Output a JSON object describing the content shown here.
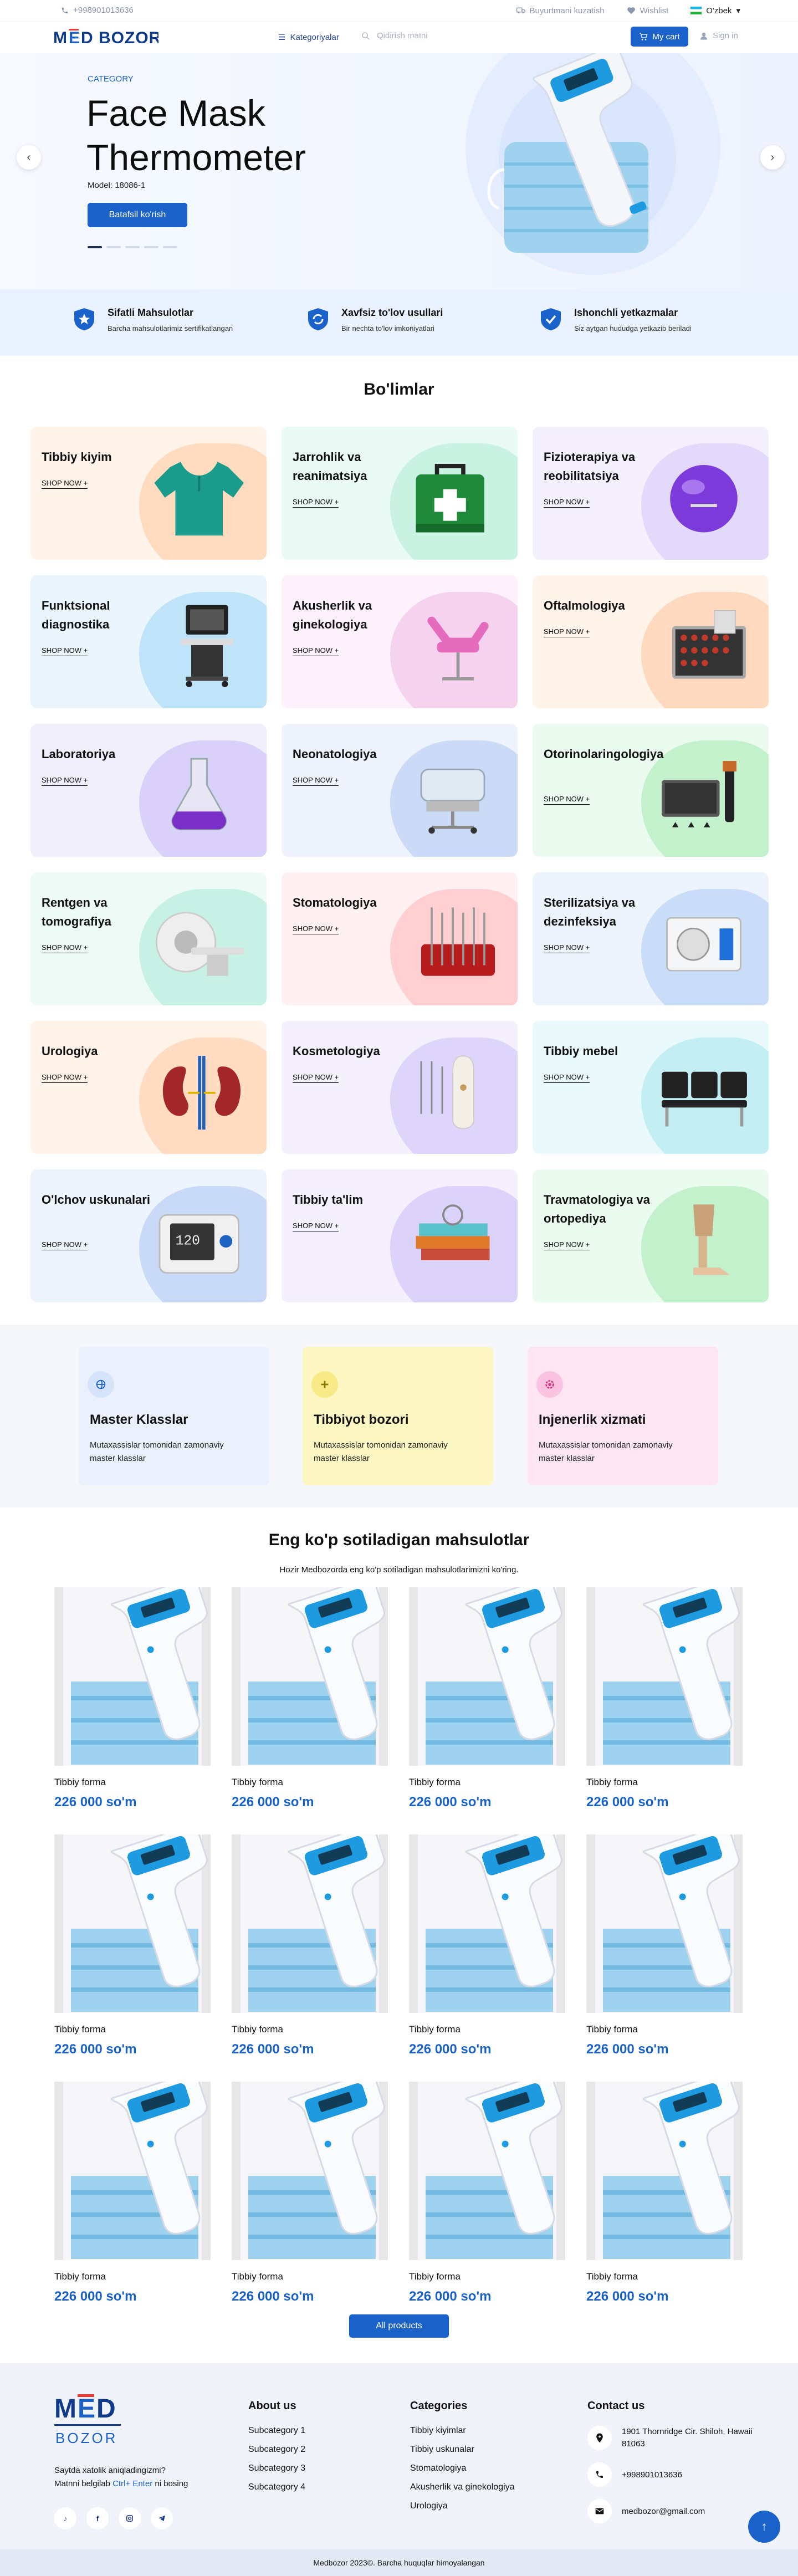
{
  "topbar": {
    "phone": "+998901013636",
    "track": "Buyurtmani kuzatish",
    "wishlist": "Wishlist",
    "language": "O'zbek"
  },
  "header": {
    "logo": "MED BOZOR",
    "categories": "Kategoriyalar",
    "search_placeholder": "Qidirish matni",
    "cart": "My cart",
    "signin": "Sign in"
  },
  "hero": {
    "category": "CATEGORY",
    "title": "Face Mask Thermometer",
    "model": "Model: 18086-1",
    "button": "Batafsil ko'rish"
  },
  "features": [
    {
      "title": "Sifatli Mahsulotlar",
      "desc": "Barcha mahsulotlarimiz sertifikatlangan"
    },
    {
      "title": "Xavfsiz to'lov usullari",
      "desc": "Bir nechta to'lov imkoniyatlari"
    },
    {
      "title": "Ishonchli yetkazmalar",
      "desc": "Siz aytgan hududga yetkazib beriladi"
    }
  ],
  "sections": {
    "title": "Bo'limlar",
    "shop": "SHOP NOW +"
  },
  "categories": [
    {
      "name": "Tibbiy kiyim",
      "icon": "scrub-shirt-icon",
      "bg": "#fff3ea",
      "blob": "#ffdcc0"
    },
    {
      "name": "Jarrohlik va reanimatsiya",
      "icon": "first-aid-kit-icon",
      "bg": "#eafaf5",
      "blob": "#c9f2e3"
    },
    {
      "name": "Fizioterapiya va reobilitatsiya",
      "icon": "fitness-ball-icon",
      "bg": "#f4f0fe",
      "blob": "#e2d9fb"
    },
    {
      "name": "Funktsional diagnostika",
      "icon": "ultrasound-machine-icon",
      "bg": "#eaf5fd",
      "blob": "#bfe3f8"
    },
    {
      "name": "Akusherlik va ginekologiya",
      "icon": "gynecology-chair-icon",
      "bg": "#fdf1fb",
      "blob": "#f5d3ef"
    },
    {
      "name": "Oftalmologiya",
      "icon": "trial-lens-case-icon",
      "bg": "#fff3ea",
      "blob": "#ffd9bd"
    },
    {
      "name": "Laboratoriya",
      "icon": "lab-flask-icon",
      "bg": "#f2effd",
      "blob": "#d9d1f9"
    },
    {
      "name": "Neonatologiya",
      "icon": "incubator-icon",
      "bg": "#eef3fd",
      "blob": "#cbdaf7"
    },
    {
      "name": "Otorinolaringologiya",
      "icon": "otoscope-kit-icon",
      "bg": "#ebfbef",
      "blob": "#c2f1cc"
    },
    {
      "name": "Rentgen va tomografiya",
      "icon": "ct-scanner-icon",
      "bg": "#edfaf6",
      "blob": "#c6f1e4"
    },
    {
      "name": "Stomatologiya",
      "icon": "dental-tools-icon",
      "bg": "#fff1f1",
      "blob": "#ffcfd1"
    },
    {
      "name": "Sterilizatsiya va dezinfeksiya",
      "icon": "autoclave-icon",
      "bg": "#eef4fd",
      "blob": "#c9dcf8"
    },
    {
      "name": "Urologiya",
      "icon": "kidneys-icon",
      "bg": "#fff3ea",
      "blob": "#ffdcc2"
    },
    {
      "name": "Kosmetologiya",
      "icon": "cosmetology-device-icon",
      "bg": "#f4f1fd",
      "blob": "#ddd5fa"
    },
    {
      "name": "Tibbiy mebel",
      "icon": "waiting-chairs-icon",
      "bg": "#eaf9fb",
      "blob": "#c2eef4"
    },
    {
      "name": "O'lchov uskunalari",
      "icon": "blood-pressure-monitor-icon",
      "bg": "#eef4fd",
      "blob": "#c8daf7"
    },
    {
      "name": "Tibbiy ta'lim",
      "icon": "medical-books-icon",
      "bg": "#f4f0fe",
      "blob": "#dcd3fa"
    },
    {
      "name": "Travmatologiya va ortopediya",
      "icon": "leg-prosthesis-icon",
      "bg": "#ecfbef",
      "blob": "#c3f1cc"
    }
  ],
  "services": [
    {
      "title": "Master Klasslar",
      "desc": "Mutaxassislar tomonidan zamonaviy master klasslar",
      "bg": "#eaf1fd",
      "icbg": "#d6e4fb",
      "icon": "globe-icon"
    },
    {
      "title": "Tibbiyot bozori",
      "desc": "Mutaxassislar tomonidan zamonaviy master klasslar",
      "bg": "#fdf7c4",
      "icbg": "#f8ea86",
      "icon": "plus-icon"
    },
    {
      "title": "Injenerlik xizmati",
      "desc": "Mutaxassislar tomonidan zamonaviy master klasslar",
      "bg": "#fde6f2",
      "icbg": "#fac4e0",
      "icon": "gear-icon"
    }
  ],
  "bestsellers": {
    "title": "Eng ko'p sotiladigan mahsulotlar",
    "subtitle": "Hozir Medbozorda eng ko'p sotiladigan mahsulotlarimizni ko'ring.",
    "all_button": "All products"
  },
  "products": [
    {
      "name": "Tibbiy forma",
      "price": "226 000 so'm"
    },
    {
      "name": "Tibbiy forma",
      "price": "226 000 so'm"
    },
    {
      "name": "Tibbiy forma",
      "price": "226 000 so'm"
    },
    {
      "name": "Tibbiy forma",
      "price": "226 000 so'm"
    },
    {
      "name": "Tibbiy forma",
      "price": "226 000 so'm"
    },
    {
      "name": "Tibbiy forma",
      "price": "226 000 so'm"
    },
    {
      "name": "Tibbiy forma",
      "price": "226 000 so'm"
    },
    {
      "name": "Tibbiy forma",
      "price": "226 000 so'm"
    },
    {
      "name": "Tibbiy forma",
      "price": "226 000 so'm"
    },
    {
      "name": "Tibbiy forma",
      "price": "226 000 so'm"
    },
    {
      "name": "Tibbiy forma",
      "price": "226 000 so'm"
    },
    {
      "name": "Tibbiy forma",
      "price": "226 000 so'm"
    }
  ],
  "footer": {
    "logo_top": "MED",
    "logo_bottom": "BOZOR",
    "help_q": "Saytda xatolik aniqladingizmi?",
    "help_pre": "Matnni belgilab ",
    "help_key": "Ctrl+ Enter",
    "help_post": " ni bosing",
    "about": {
      "title": "About us",
      "items": [
        "Subcategory 1",
        "Subcategory 2",
        "Subcategory 3",
        "Subcategory 4"
      ]
    },
    "cats": {
      "title": "Categories",
      "items": [
        "Tibbiy kiyimlar",
        "Tibbiy uskunalar",
        "Stomatologiya",
        "Akusherlik va ginekologiya",
        "Urologiya"
      ]
    },
    "contact": {
      "title": "Contact us",
      "address": "1901 Thornridge Cir. Shiloh, Hawaii 81063",
      "phone": "+998901013636",
      "email": "medbozor@gmail.com"
    },
    "copyright": "Medbozor 2023©. Barcha huquqlar himoyalangan"
  },
  "colors": {
    "accent": "#1a62c9",
    "brand": "#0f3a8c"
  }
}
